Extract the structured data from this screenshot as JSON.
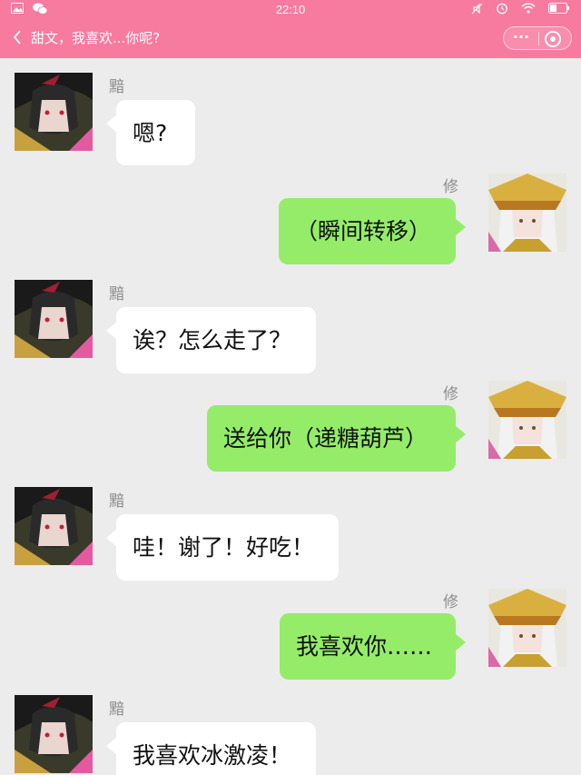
{
  "status_bar": {
    "time": "22:10",
    "left_icons": [
      "image-icon",
      "wechat-icon"
    ],
    "right_icons": [
      "mute-icon",
      "alarm-icon",
      "wifi-icon",
      "battery-icon"
    ]
  },
  "header": {
    "title": "甜文，我喜欢...你呢?",
    "back_icon": "chevron-left-icon",
    "more_icon": "more-dots-icon",
    "close_icon": "target-icon"
  },
  "colors": {
    "header_bg": "#f77a9f",
    "chat_bg": "#ececec",
    "bubble_right": "#95ec69",
    "bubble_left": "#ffffff"
  },
  "messages": [
    {
      "side": "left",
      "sender": "黯",
      "text": "嗯?"
    },
    {
      "side": "right",
      "sender": "修",
      "text": "（瞬间转移）"
    },
    {
      "side": "left",
      "sender": "黯",
      "text": "诶？怎么走了？"
    },
    {
      "side": "right",
      "sender": "修",
      "text": "送给你（递糖葫芦）"
    },
    {
      "side": "left",
      "sender": "黯",
      "text": "哇！谢了！好吃！"
    },
    {
      "side": "right",
      "sender": "修",
      "text": "我喜欢你……"
    },
    {
      "side": "left",
      "sender": "黯",
      "text": "我喜欢冰激凌！"
    }
  ]
}
